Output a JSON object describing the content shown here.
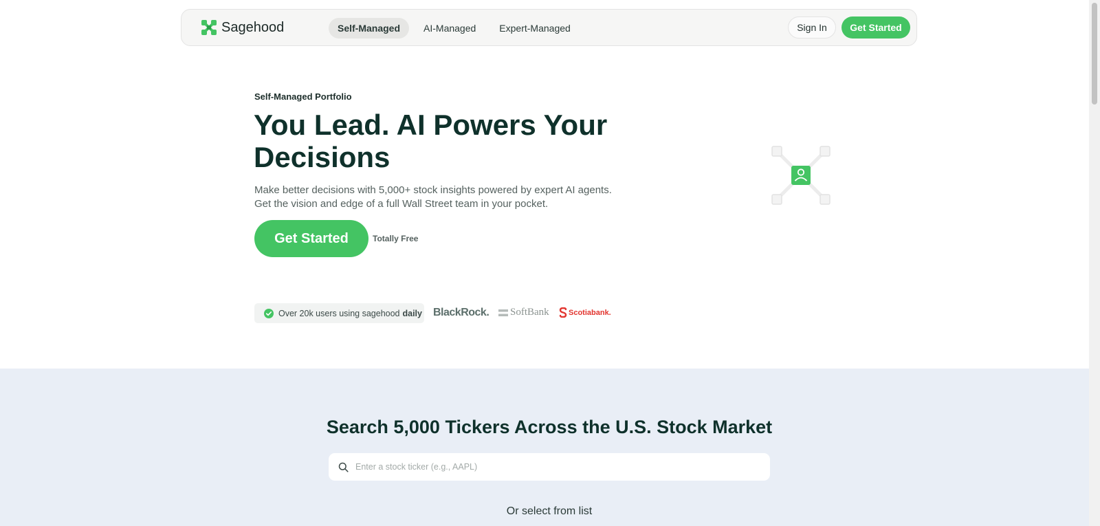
{
  "colors": {
    "brand_green": "#44c463",
    "heading": "#0f312b",
    "search_section_bg": "#e9eef6",
    "scotiabank_red": "#e2352f"
  },
  "header": {
    "logo_icon": "sagehood-logo-icon",
    "brand": "Sagehood",
    "nav": [
      {
        "label": "Self-Managed",
        "active": true
      },
      {
        "label": "AI-Managed",
        "active": false
      },
      {
        "label": "Expert-Managed",
        "active": false
      }
    ],
    "sign_in": "Sign In",
    "get_started": "Get Started"
  },
  "hero": {
    "eyebrow": "Self-Managed Portfolio",
    "title": "You Lead. AI Powers Your Decisions",
    "subtitle": "Make better decisions with 5,000+ stock insights powered by expert AI agents. Get the vision and edge of a full Wall Street team in your pocket.",
    "cta": "Get Started",
    "cta_note": "Totally Free",
    "illustration_icon": "network-user-icon"
  },
  "trust": {
    "badge_icon": "check-circle-icon",
    "badge_text": "Over 20k users using sagehood",
    "badge_bold": "daily",
    "partners": [
      "BlackRock.",
      "SoftBank",
      "Scotiabank."
    ]
  },
  "search": {
    "title": "Search 5,000 Tickers Across the U.S. Stock Market",
    "icon": "search-icon",
    "placeholder": "Enter a stock ticker (e.g., AAPL)",
    "value": "",
    "or_select": "Or select from list"
  }
}
